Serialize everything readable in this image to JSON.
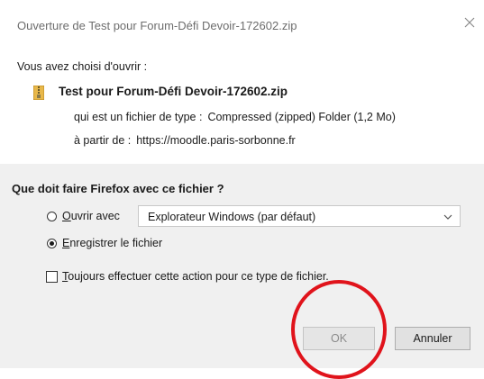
{
  "window": {
    "title": "Ouverture de Test pour Forum-Défi Devoir-172602.zip"
  },
  "info": {
    "intro": "Vous avez choisi d'ouvrir :",
    "file_name": "Test pour Forum-Défi Devoir-172602.zip",
    "type_label": "qui est un fichier de type :",
    "type_value": "Compressed (zipped) Folder (1,2 Mo)",
    "from_label": "à partir de :",
    "from_value": "https://moodle.paris-sorbonne.fr",
    "file_icon": "zip-folder-icon"
  },
  "action": {
    "question": "Que doit faire Firefox avec ce fichier ?",
    "open_with": {
      "key": "O",
      "rest": "uvrir avec",
      "selected": false
    },
    "app_select": {
      "value": "Explorateur Windows (par défaut)"
    },
    "save_file": {
      "key": "E",
      "rest": "nregistrer le fichier",
      "selected": true
    },
    "always": {
      "key": "T",
      "rest": "oujours effectuer cette action pour ce type de fichier.",
      "checked": false
    }
  },
  "buttons": {
    "ok": "OK",
    "cancel": "Annuler"
  },
  "colors": {
    "annotation_circle": "#e0131b",
    "bottom_panel": "#f0f0f0"
  }
}
